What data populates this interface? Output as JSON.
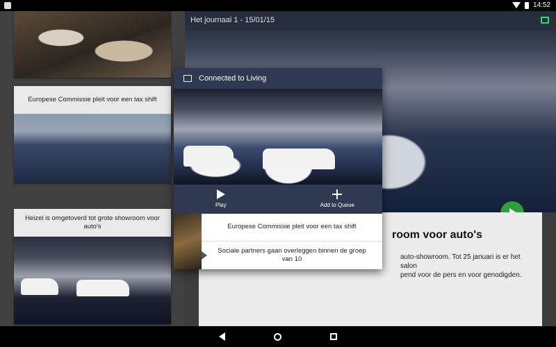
{
  "status_bar": {
    "time": "14:52"
  },
  "main": {
    "header_title": "Het journaal 1 - 15/01/15",
    "article_title": "room voor auto's",
    "article_body": "auto-showroom. Tot 25 januari is er het salon\npend voor de pers en voor genodigden."
  },
  "left_cards": [
    {
      "title": ""
    },
    {
      "title": "Europese Commissie pleit voor een tax shift"
    },
    {
      "title": "Heizel is omgetoverd tot grote showroom voor auto's"
    }
  ],
  "dialog": {
    "title": "Connected to Living",
    "play_label": "Play",
    "add_label": "Add to Queue",
    "queue": [
      "Europese Commissie pleit voor een tax shift",
      "Sociale partners gaan overleggen binnen de groep van 10"
    ]
  },
  "colors": {
    "accent_green": "#2e9e3e",
    "dialog_bg": "#2f3a52",
    "cast_green": "#3fd17c"
  },
  "icons": [
    "app-icon",
    "wifi-icon",
    "battery-icon",
    "cast-icon",
    "play-icon",
    "add-icon",
    "back-icon",
    "home-icon",
    "recents-icon"
  ]
}
